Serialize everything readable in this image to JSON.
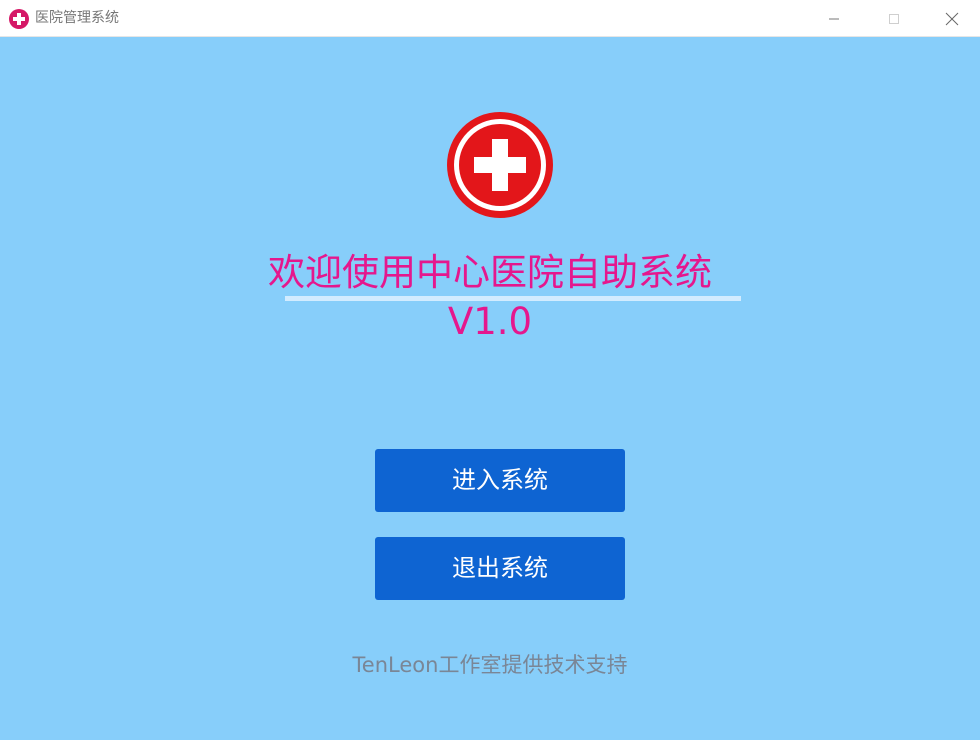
{
  "window": {
    "title": "医院管理系统",
    "icon": "medical-cross-icon",
    "controls": [
      "minimize-icon",
      "maximize-icon",
      "close-icon"
    ]
  },
  "main": {
    "logo_icon": "medical-cross-icon",
    "welcome_text": "欢迎使用中心医院自助系统",
    "version_text": "V1.0",
    "enter_button_label": "进入系统",
    "exit_button_label": "退出系统",
    "footer_text": "TenLeon工作室提供技术支持"
  },
  "colors": {
    "background": "#87cefa",
    "heading": "#e5178d",
    "button": "#0e64d2",
    "logo_red": "#e3161a",
    "title_icon": "#d51867",
    "footer": "#7a8696"
  }
}
